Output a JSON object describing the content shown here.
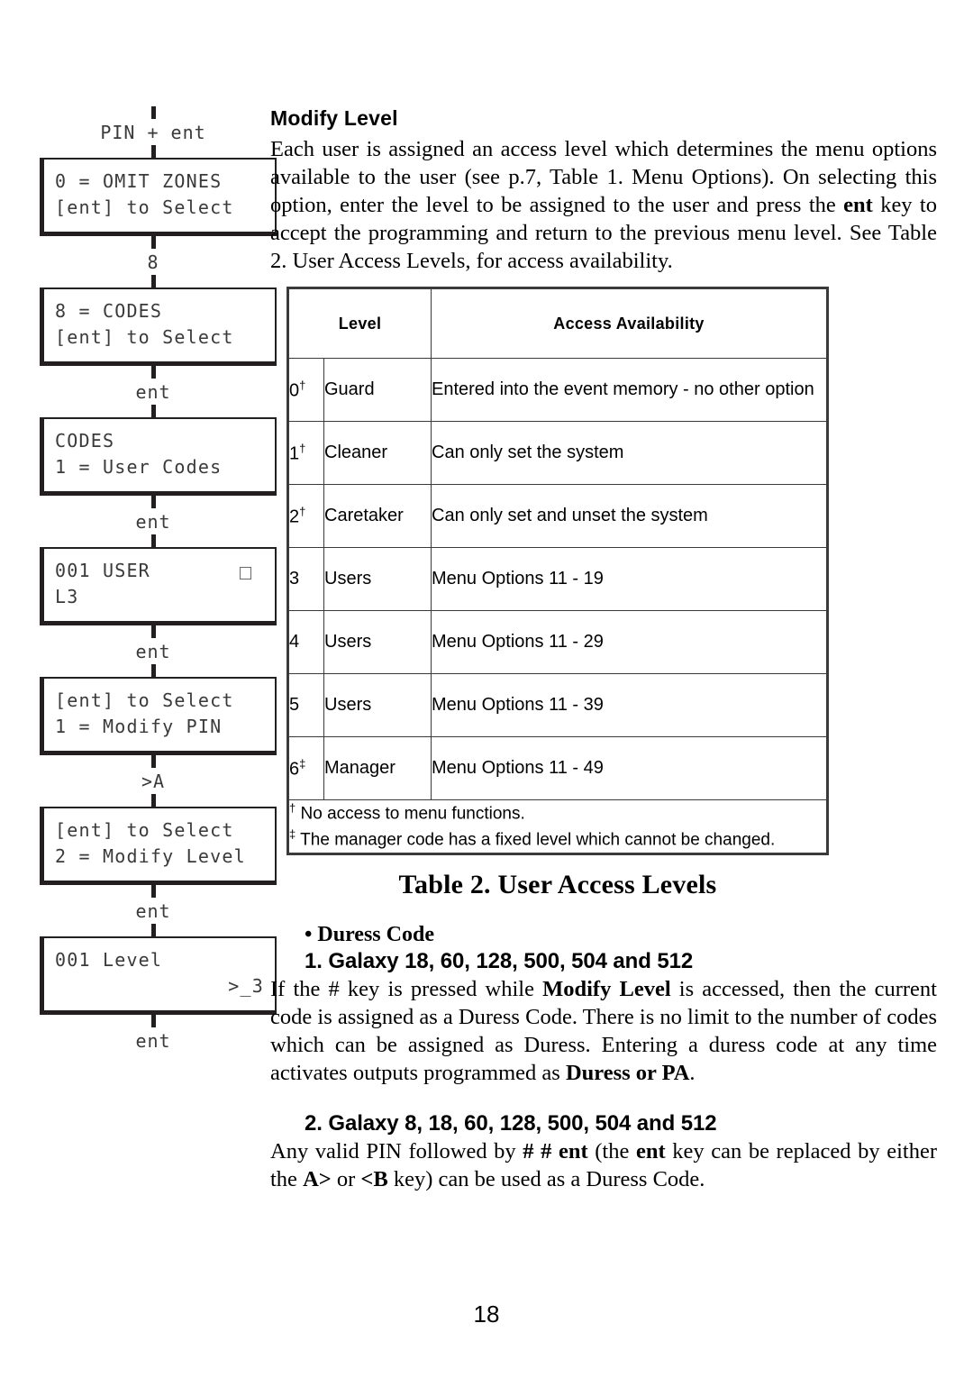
{
  "flowchart": {
    "nodes": [
      {
        "kind": "connector",
        "label": "PIN + ent"
      },
      {
        "kind": "box",
        "line1": "0 = OMIT ZONES",
        "line2": "[ent] to Select"
      },
      {
        "kind": "connector",
        "label": "8"
      },
      {
        "kind": "box",
        "line1": "8 = CODES",
        "line2": "[ent] to Select"
      },
      {
        "kind": "connector",
        "label": "ent"
      },
      {
        "kind": "box",
        "line1": "CODES",
        "line2": "1 = User Codes"
      },
      {
        "kind": "connector",
        "label": "ent"
      },
      {
        "kind": "box",
        "line1": "001 USER",
        "line2": "L3",
        "cursor": true
      },
      {
        "kind": "connector",
        "label": "ent"
      },
      {
        "kind": "box",
        "line1": "[ent] to Select",
        "line2": "1 = Modify PIN"
      },
      {
        "kind": "connector",
        "label": ">A"
      },
      {
        "kind": "box",
        "line1": "[ent] to Select",
        "line2": "2 = Modify Level"
      },
      {
        "kind": "connector",
        "label": "ent"
      },
      {
        "kind": "box",
        "line1": "001 Level",
        "line2": ">_3",
        "line2_align": "right"
      },
      {
        "kind": "connector",
        "label": "ent"
      }
    ]
  },
  "section": {
    "heading": "Modify Level",
    "intro_part1": "Each user is assigned an access level which determines the menu options available to the user (see p.7, Table 1. Menu Options). On selecting this option, enter the level to be assigned to the user and press the ",
    "intro_bold": "ent",
    "intro_part2": " key to accept the programming and return to the previous menu level.  See Table 2. User Access Levels, for access availability."
  },
  "table": {
    "headers": {
      "level": "Level",
      "access": "Access Availability"
    },
    "rows": [
      {
        "num": "0",
        "mark": "†",
        "role": "Guard",
        "access": "Entered into the event memory - no other option"
      },
      {
        "num": "1",
        "mark": "†",
        "role": "Cleaner",
        "access": "Can only set the system"
      },
      {
        "num": "2",
        "mark": "†",
        "role": "Caretaker",
        "access": "Can only set and unset the system"
      },
      {
        "num": "3",
        "mark": "",
        "role": "Users",
        "access": "Menu Options 11 - 19"
      },
      {
        "num": "4",
        "mark": "",
        "role": "Users",
        "access": "Menu Options 11 - 29"
      },
      {
        "num": "5",
        "mark": "",
        "role": "Users",
        "access": "Menu Options 11 - 39"
      },
      {
        "num": "6",
        "mark": "‡",
        "role": "Manager",
        "access": "Menu Options 11 - 49"
      }
    ],
    "footnotes": [
      {
        "mark": "†",
        "text": " No access to menu functions."
      },
      {
        "mark": "‡",
        "text": " The manager code has a fixed level which cannot be changed."
      }
    ],
    "caption": "Table 2. User Access Levels"
  },
  "duress": {
    "bullet_heading": "• Duress Code",
    "item1_heading": "1. Galaxy 18, 60, 128, 500, 504 and 512",
    "item1_p1": "If  the # key is pressed while ",
    "item1_b1": "Modify Level",
    "item1_p2": " is accessed, then the current code is assigned as a Duress Code. There is no limit to the number of codes which can be assigned as Duress. Entering a duress code at any time activates outputs programmed as ",
    "item1_b2": "Duress or PA",
    "item1_p3": ".",
    "item2_heading": "2. Galaxy 8, 18, 60, 128, 500, 504 and 512",
    "item2_p1": "Any valid PIN followed by ",
    "item2_b1": "# # ent",
    "item2_p2": " (the ",
    "item2_b2": "ent",
    "item2_p3": " key can be replaced by either the ",
    "item2_b3": "A>",
    "item2_p4": " or ",
    "item2_b4": "<B",
    "item2_p5": " key) can be used as a Duress Code."
  },
  "page_number": "18"
}
